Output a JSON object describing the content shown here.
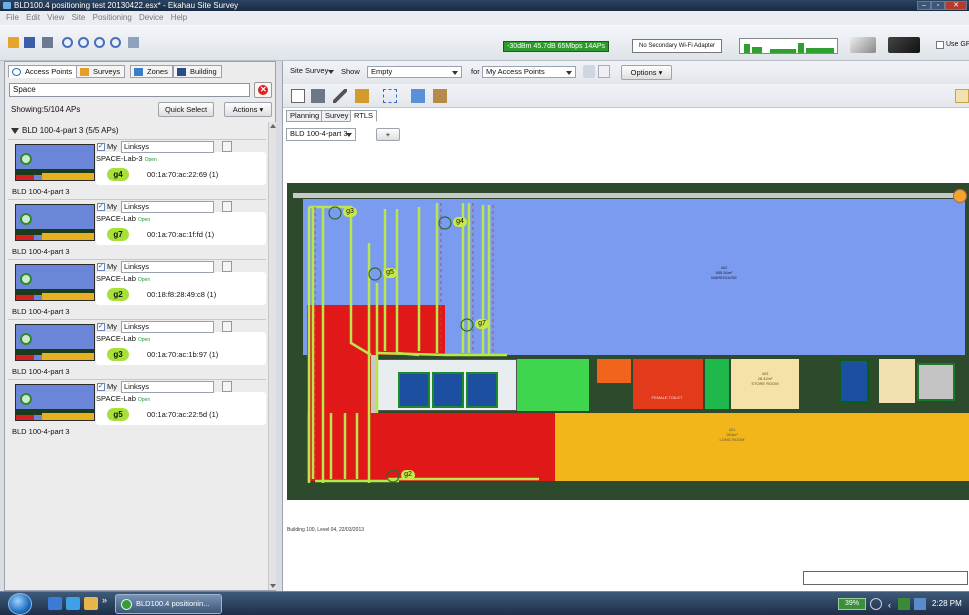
{
  "window": {
    "title": "BLD100.4 positioning test 20130422.esx* - Ekahau Site Survey",
    "min": "–",
    "max": "▫",
    "close": "✕"
  },
  "menu": [
    "File",
    "Edit",
    "View",
    "Site",
    "Positioning",
    "Device",
    "Help"
  ],
  "status": {
    "signal": "-30dBm  45.7dB  65Mbps  14APs",
    "adapter": "No Secondary Wi-Fi Adapter",
    "use_gps": "Use GPS"
  },
  "left": {
    "tabs": [
      "Access Points",
      "Surveys",
      "Zones",
      "Building"
    ],
    "search_value": "Space",
    "showing": "Showing:5/104 APs",
    "quick_select": "Quick Select",
    "actions": "Actions ▾",
    "group": "BLD 100-4-part 3 (5/5 APs)",
    "my_label": "My",
    "open_label": "Open",
    "aps": [
      {
        "ssid": "Linksys",
        "name": "SPACE-Lab-3",
        "channel": "g4",
        "mac": "00:1a:70:ac:22:69 (1)",
        "building": "BLD 100-4-part 3"
      },
      {
        "ssid": "Linksys",
        "name": "SPACE-Lab",
        "channel": "g7",
        "mac": "00:1a:70:ac:1f:fd (1)",
        "building": "BLD 100-4-part 3"
      },
      {
        "ssid": "Linksys",
        "name": "SPACE-Lab",
        "channel": "g2",
        "mac": "00:18:f8:28:49:c8 (1)",
        "building": "BLD 100-4-part 3"
      },
      {
        "ssid": "Linksys",
        "name": "SPACE-Lab",
        "channel": "g3",
        "mac": "00:1a:70:ac:1b:97 (1)",
        "building": "BLD 100-4-part 3"
      },
      {
        "ssid": "Linksys",
        "name": "SPACE-Lab",
        "channel": "g5",
        "mac": "00:1a:70:ac:22:5d (1)",
        "building": "BLD 100-4-part 3"
      }
    ]
  },
  "right": {
    "mode": "Site Survey",
    "show_label": "Show",
    "show_value": "Empty",
    "for_label": "for",
    "for_value": "My Access Points",
    "options": "Options ▾",
    "tabs": [
      "Planning",
      "Survey",
      "RTLS"
    ],
    "floor": "BLD 100-4-part 3",
    "add": "+",
    "caption": "Building 100, Level 04, 22/03/2013",
    "map_aps": [
      "g3",
      "g4",
      "g5",
      "g7",
      "g2"
    ],
    "rooms": {
      "warehouse": "WAREHOUSE",
      "warehouse_num": "402",
      "warehouse_area": "555.54m²",
      "long_room": "LONG ROOM",
      "long_room_num": "401",
      "long_room_area": "263m²",
      "store_room": "STORE ROOM",
      "store_room_num": "403",
      "store_room_area": "28.42m²",
      "female": "FEMALE TOILET"
    }
  },
  "taskbar": {
    "item": "BLD100.4 positionin...",
    "chevron": "»",
    "battery": "39%",
    "time": "2:28 PM"
  },
  "colors": {
    "ap_channel": "#a8e03a",
    "warehouse": "#7b9bf0",
    "red_zone": "#e01818",
    "yellow_zone": "#f2b61a",
    "floor_bg": "#2d4a2d"
  }
}
